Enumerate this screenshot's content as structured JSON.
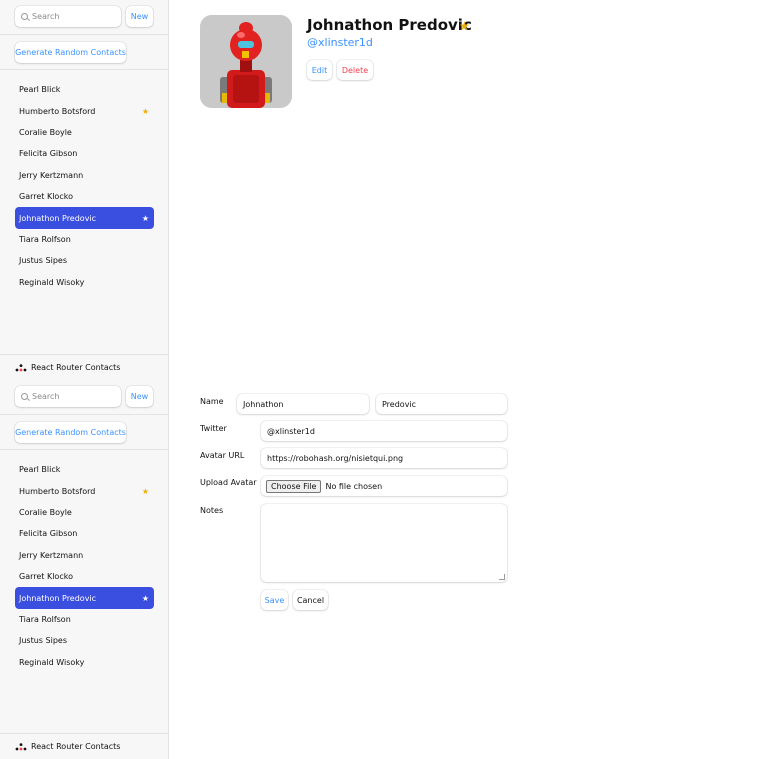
{
  "sidebar": {
    "search_placeholder": "Search",
    "new_label": "New",
    "generate_label": "Generate Random Contacts",
    "brand": "React Router Contacts",
    "contacts": [
      {
        "name": "Pearl Blick",
        "favorite": false,
        "active": false
      },
      {
        "name": "Humberto Botsford",
        "favorite": true,
        "active": false
      },
      {
        "name": "Coralie Boyle",
        "favorite": false,
        "active": false
      },
      {
        "name": "Felicita Gibson",
        "favorite": false,
        "active": false
      },
      {
        "name": "Jerry Kertzmann",
        "favorite": false,
        "active": false
      },
      {
        "name": "Garret Klocko",
        "favorite": false,
        "active": false
      },
      {
        "name": "Johnathon Predovic",
        "favorite": true,
        "active": true
      },
      {
        "name": "Tiara Rolfson",
        "favorite": false,
        "active": false
      },
      {
        "name": "Justus Sipes",
        "favorite": false,
        "active": false
      },
      {
        "name": "Reginald Wisoky",
        "favorite": false,
        "active": false
      }
    ]
  },
  "contact": {
    "name": "Johnathon Predovic",
    "favorite_star": "★",
    "twitter": "@xlinster1d",
    "edit_label": "Edit",
    "delete_label": "Delete"
  },
  "form": {
    "name_label": "Name",
    "first_name": "Johnathon",
    "last_name": "Predovic",
    "twitter_label": "Twitter",
    "twitter_value": "@xlinster1d",
    "avatar_label": "Avatar URL",
    "avatar_value": "https://robohash.org/nisietqui.png",
    "upload_label": "Upload Avatar",
    "choose_file_label": "Choose File",
    "no_file_text": "No file chosen",
    "notes_label": "Notes",
    "notes_value": "",
    "save_label": "Save",
    "cancel_label": "Cancel"
  },
  "colors": {
    "accent": "#3992ff",
    "active_bg": "#3a4ee0",
    "star": "#eeb004",
    "danger": "#f44250"
  }
}
